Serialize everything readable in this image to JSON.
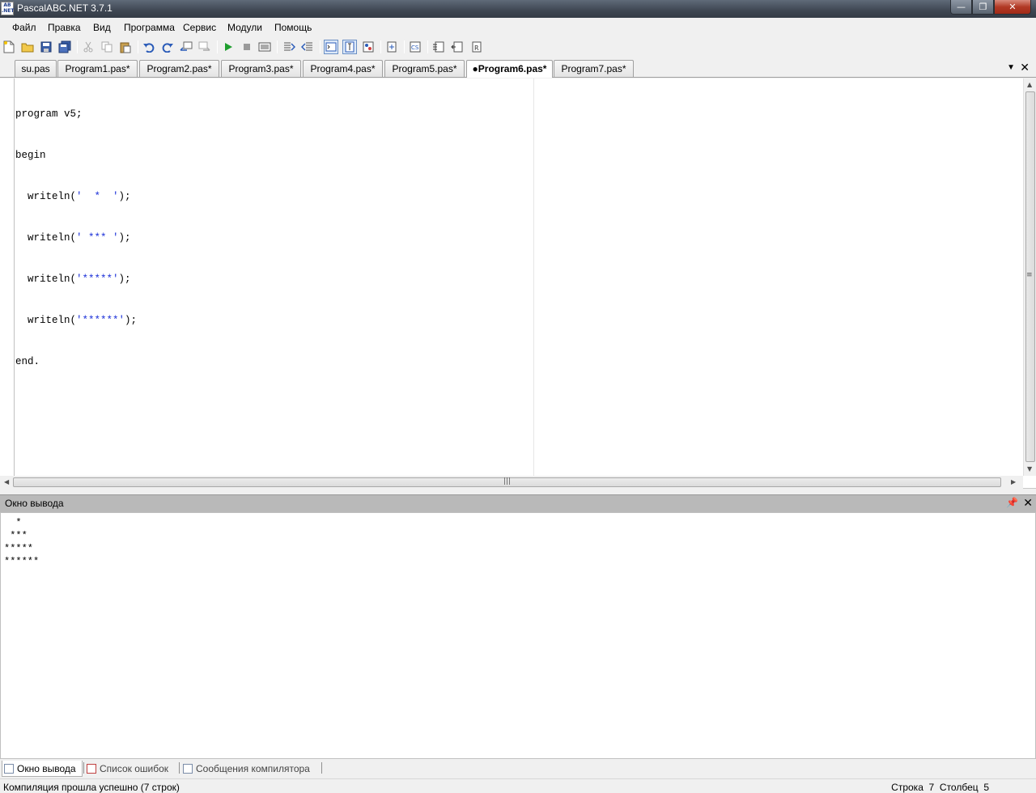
{
  "window": {
    "title": "PascalABC.NET 3.7.1",
    "app_icon_text": "ABC",
    "buttons": [
      "minimize",
      "maximize",
      "close"
    ]
  },
  "menu": {
    "items": [
      {
        "label": "Файл"
      },
      {
        "label": "Правка"
      },
      {
        "label": "Вид"
      },
      {
        "label": "Программа"
      },
      {
        "label": "Сервис"
      },
      {
        "label": "Модули"
      },
      {
        "label": "Помощь"
      }
    ]
  },
  "toolbar": {
    "buttons": [
      {
        "icon": "new-file-icon"
      },
      {
        "icon": "open-folder-icon"
      },
      {
        "icon": "save-icon"
      },
      {
        "icon": "save-all-icon"
      },
      {
        "icon": "cut-icon"
      },
      {
        "icon": "copy-icon"
      },
      {
        "icon": "paste-icon"
      },
      {
        "icon": "undo-icon"
      },
      {
        "icon": "redo-icon"
      },
      {
        "icon": "navigate-back-icon"
      },
      {
        "icon": "navigate-forward-icon"
      },
      {
        "icon": "run-icon"
      },
      {
        "icon": "stop-icon"
      },
      {
        "icon": "compile-icon"
      },
      {
        "icon": "step-over-icon"
      },
      {
        "icon": "step-into-icon"
      },
      {
        "icon": "output-window-icon"
      },
      {
        "icon": "form-designer-icon"
      },
      {
        "icon": "code-format-icon"
      },
      {
        "icon": "debug-icon"
      },
      {
        "icon": "watch-icon"
      },
      {
        "icon": "module-icon"
      },
      {
        "icon": "module-up-icon"
      },
      {
        "icon": "module-run-icon"
      }
    ]
  },
  "tabs": {
    "items": [
      {
        "label": "su.pas"
      },
      {
        "label": "Program1.pas*"
      },
      {
        "label": "Program2.pas*"
      },
      {
        "label": "Program3.pas*"
      },
      {
        "label": "Program4.pas*"
      },
      {
        "label": "Program5.pas*"
      },
      {
        "label": "●Program6.pas*"
      },
      {
        "label": "Program7.pas*"
      }
    ],
    "active_index": 6
  },
  "editor": {
    "lines": [
      {
        "pre": "program v5;",
        "str": "",
        "post": ""
      },
      {
        "pre": "begin",
        "str": "",
        "post": ""
      },
      {
        "pre": "  writeln(",
        "str": "'  *  '",
        "post": ");"
      },
      {
        "pre": "  writeln(",
        "str": "' *** '",
        "post": ");"
      },
      {
        "pre": "  writeln(",
        "str": "'*****'",
        "post": ");"
      },
      {
        "pre": "  writeln(",
        "str": "'******'",
        "post": ");"
      },
      {
        "pre": "end.",
        "str": "",
        "post": ""
      }
    ]
  },
  "output_panel": {
    "title": "Окно вывода",
    "text": "  *\n ***\n*****\n******"
  },
  "bottom_tabs": {
    "items": [
      {
        "label": "Окно вывода"
      },
      {
        "label": "Список ошибок"
      },
      {
        "label": "Сообщения компилятора"
      }
    ],
    "active_index": 0
  },
  "status": {
    "message": "Компиляция прошла успешно (7 строк)",
    "line_label": "Строка",
    "line": "7",
    "col_label": "Столбец",
    "col": "5"
  },
  "colors": {
    "string_literal": "#1a2fd8",
    "titlebar": "#3e4652",
    "output_header": "#b9b9b9"
  }
}
